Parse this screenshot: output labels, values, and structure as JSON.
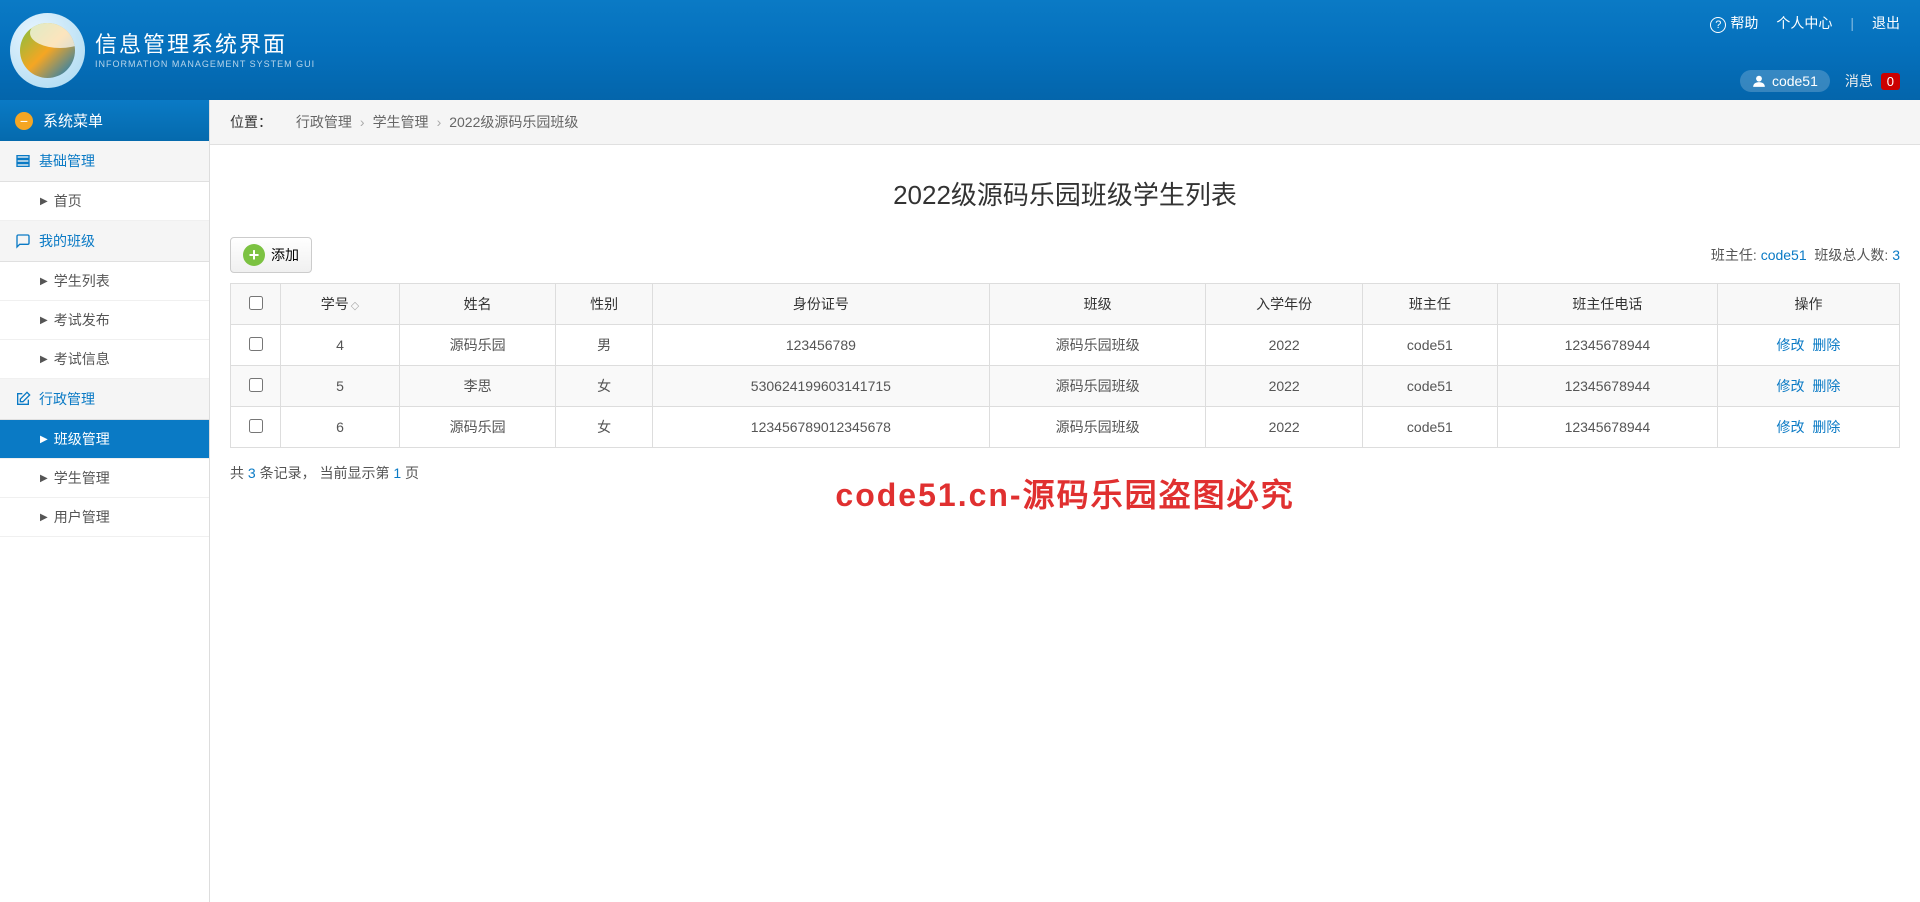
{
  "header": {
    "title": "信息管理系统界面",
    "subtitle": "INFORMATION MANAGEMENT SYSTEM GUI",
    "links": {
      "help": "帮助",
      "center": "个人中心",
      "logout": "退出"
    },
    "username": "code51",
    "message_label": "消息",
    "message_count": "0"
  },
  "sidebar": {
    "title": "系统菜单",
    "sections": [
      {
        "label": "基础管理",
        "icon": "list",
        "items": [
          {
            "label": "首页"
          }
        ]
      },
      {
        "label": "我的班级",
        "icon": "chat",
        "items": [
          {
            "label": "学生列表"
          },
          {
            "label": "考试发布"
          },
          {
            "label": "考试信息"
          }
        ]
      },
      {
        "label": "行政管理",
        "icon": "edit",
        "items": [
          {
            "label": "班级管理",
            "active": true
          },
          {
            "label": "学生管理"
          },
          {
            "label": "用户管理"
          }
        ]
      }
    ]
  },
  "breadcrumb": {
    "label": "位置：",
    "items": [
      "行政管理",
      "学生管理",
      "2022级源码乐园班级"
    ]
  },
  "page": {
    "title": "2022级源码乐园班级学生列表",
    "add_button": "添加",
    "teacher_label": "班主任:",
    "teacher_name": "code51",
    "total_label": "班级总人数:",
    "total_count": "3"
  },
  "table": {
    "columns": [
      "学号",
      "姓名",
      "性别",
      "身份证号",
      "班级",
      "入学年份",
      "班主任",
      "班主任电话",
      "操作"
    ],
    "rows": [
      {
        "id": "4",
        "name": "源码乐园",
        "gender": "男",
        "idcard": "123456789",
        "class": "源码乐园班级",
        "year": "2022",
        "teacher": "code51",
        "phone": "12345678944"
      },
      {
        "id": "5",
        "name": "李思",
        "gender": "女",
        "idcard": "530624199603141715",
        "class": "源码乐园班级",
        "year": "2022",
        "teacher": "code51",
        "phone": "12345678944"
      },
      {
        "id": "6",
        "name": "源码乐园",
        "gender": "女",
        "idcard": "123456789012345678",
        "class": "源码乐园班级",
        "year": "2022",
        "teacher": "code51",
        "phone": "12345678944"
      }
    ],
    "actions": {
      "edit": "修改",
      "delete": "删除"
    }
  },
  "pagination": {
    "prefix": "共 ",
    "total": "3",
    "mid1": " 条记录，  当前显示第 ",
    "page": "1",
    "suffix": " 页"
  },
  "watermark": "code51.cn-源码乐园盗图必究"
}
